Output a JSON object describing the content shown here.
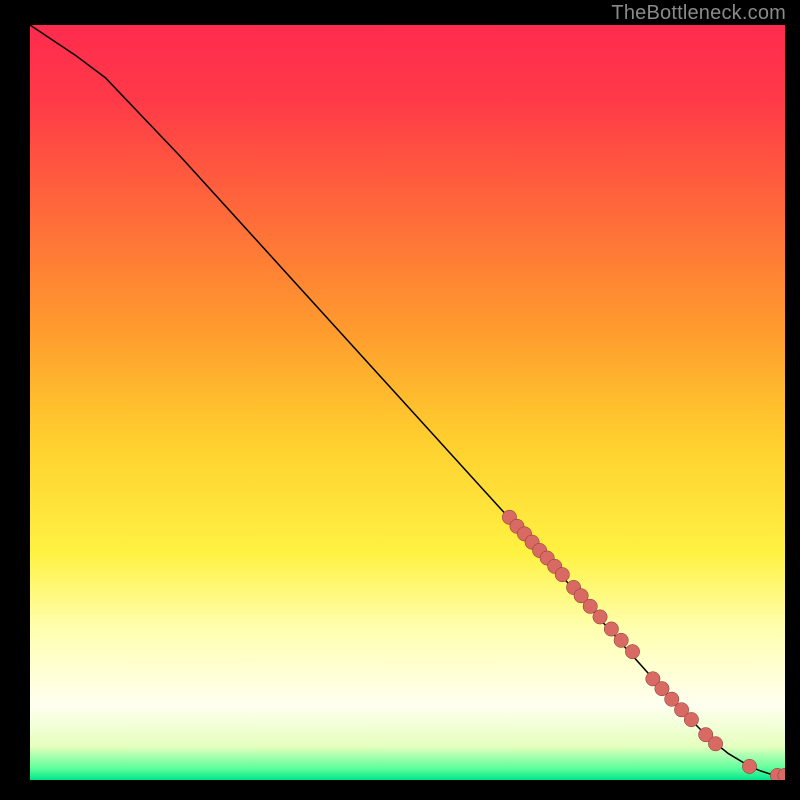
{
  "watermark": "TheBottleneck.com",
  "palette": {
    "page_bg": "#000000",
    "watermark_color": "#8a8a8a",
    "curve_color": "#000000",
    "marker_fill": "#d96a63",
    "marker_stroke": "#80352e",
    "gradient_stops": [
      {
        "offset": 0.0,
        "color": "#ff2b4e"
      },
      {
        "offset": 0.1,
        "color": "#ff3a48"
      },
      {
        "offset": 0.25,
        "color": "#ff6a3a"
      },
      {
        "offset": 0.4,
        "color": "#ff9a2e"
      },
      {
        "offset": 0.55,
        "color": "#ffcf2e"
      },
      {
        "offset": 0.7,
        "color": "#fff243"
      },
      {
        "offset": 0.8,
        "color": "#ffffb0"
      },
      {
        "offset": 0.9,
        "color": "#fffff0"
      },
      {
        "offset": 0.955,
        "color": "#e6ffbf"
      },
      {
        "offset": 0.985,
        "color": "#5cff9c"
      },
      {
        "offset": 1.0,
        "color": "#00e58a"
      }
    ]
  },
  "chart_data": {
    "type": "line",
    "title": "",
    "xlabel": "",
    "ylabel": "",
    "xlim": [
      0,
      100
    ],
    "ylim": [
      0,
      100
    ],
    "legend": false,
    "grid": false,
    "series": [
      {
        "name": "curve",
        "style": "line",
        "x": [
          0,
          3,
          6,
          10,
          20,
          30,
          40,
          50,
          60,
          70,
          78,
          82,
          86,
          90,
          92.5,
          95,
          96.5,
          98,
          99,
          100
        ],
        "y": [
          100,
          98,
          96,
          93,
          82.5,
          71.5,
          60.5,
          49.5,
          38.5,
          27.5,
          18.5,
          14,
          9.5,
          5.5,
          3.5,
          2.0,
          1.3,
          0.8,
          0.5,
          0.5
        ]
      },
      {
        "name": "cluster-top",
        "style": "points",
        "x": [
          63.5,
          64.5,
          65.5,
          66.5,
          67.5,
          68.5,
          69.5,
          70.5,
          72.0,
          73.0,
          74.2,
          75.5,
          77.0,
          78.3,
          79.8
        ],
        "y": [
          34.8,
          33.6,
          32.6,
          31.5,
          30.4,
          29.4,
          28.3,
          27.2,
          25.5,
          24.4,
          23.0,
          21.6,
          20.0,
          18.5,
          17.0
        ]
      },
      {
        "name": "cluster-mid",
        "style": "points",
        "x": [
          82.5,
          83.7,
          85.0,
          86.3,
          87.6
        ],
        "y": [
          13.4,
          12.1,
          10.7,
          9.3,
          8.0
        ]
      },
      {
        "name": "cluster-low",
        "style": "points",
        "x": [
          89.5,
          90.8
        ],
        "y": [
          6.0,
          4.8
        ]
      },
      {
        "name": "cluster-bottom",
        "style": "points",
        "x": [
          95.3,
          99.0,
          100.0
        ],
        "y": [
          1.8,
          0.6,
          0.6
        ]
      }
    ]
  }
}
